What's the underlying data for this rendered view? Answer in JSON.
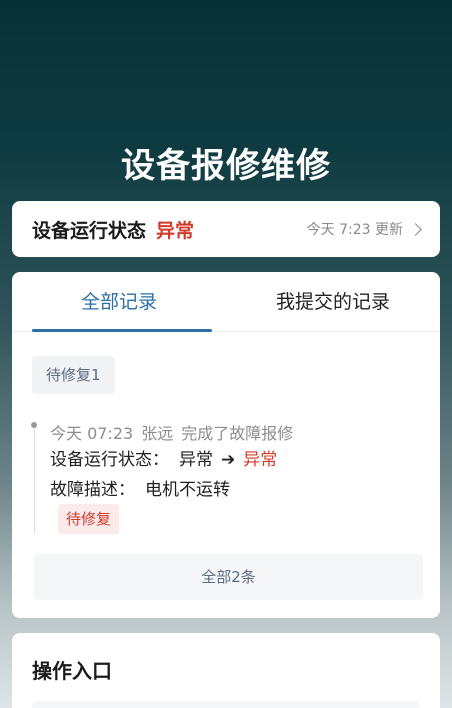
{
  "header": {
    "title": "设备报修维修"
  },
  "status": {
    "label": "设备运行状态",
    "value": "异常",
    "updated": "今天 7:23 更新"
  },
  "tabs": [
    {
      "label": "全部记录",
      "active": true
    },
    {
      "label": "我提交的记录",
      "active": false
    }
  ],
  "records": {
    "filter_tag": "待修复1",
    "log": {
      "time": "今天 07:23",
      "user": "张远",
      "action": "完成了故障报修",
      "status_label": "设备运行状态：",
      "status_from": "异常",
      "status_to": "异常",
      "desc_label": "故障描述：",
      "desc_value": "电机不运转",
      "tag": "待修复"
    },
    "all_button": "全部2条"
  },
  "operations": {
    "title": "操作入口"
  },
  "colors": {
    "accent": "#2d6fa6",
    "danger": "#d23b2c"
  },
  "icons": {
    "status_chevron": "chevron-right-icon",
    "transition_arrow": "arrow-right-icon"
  }
}
